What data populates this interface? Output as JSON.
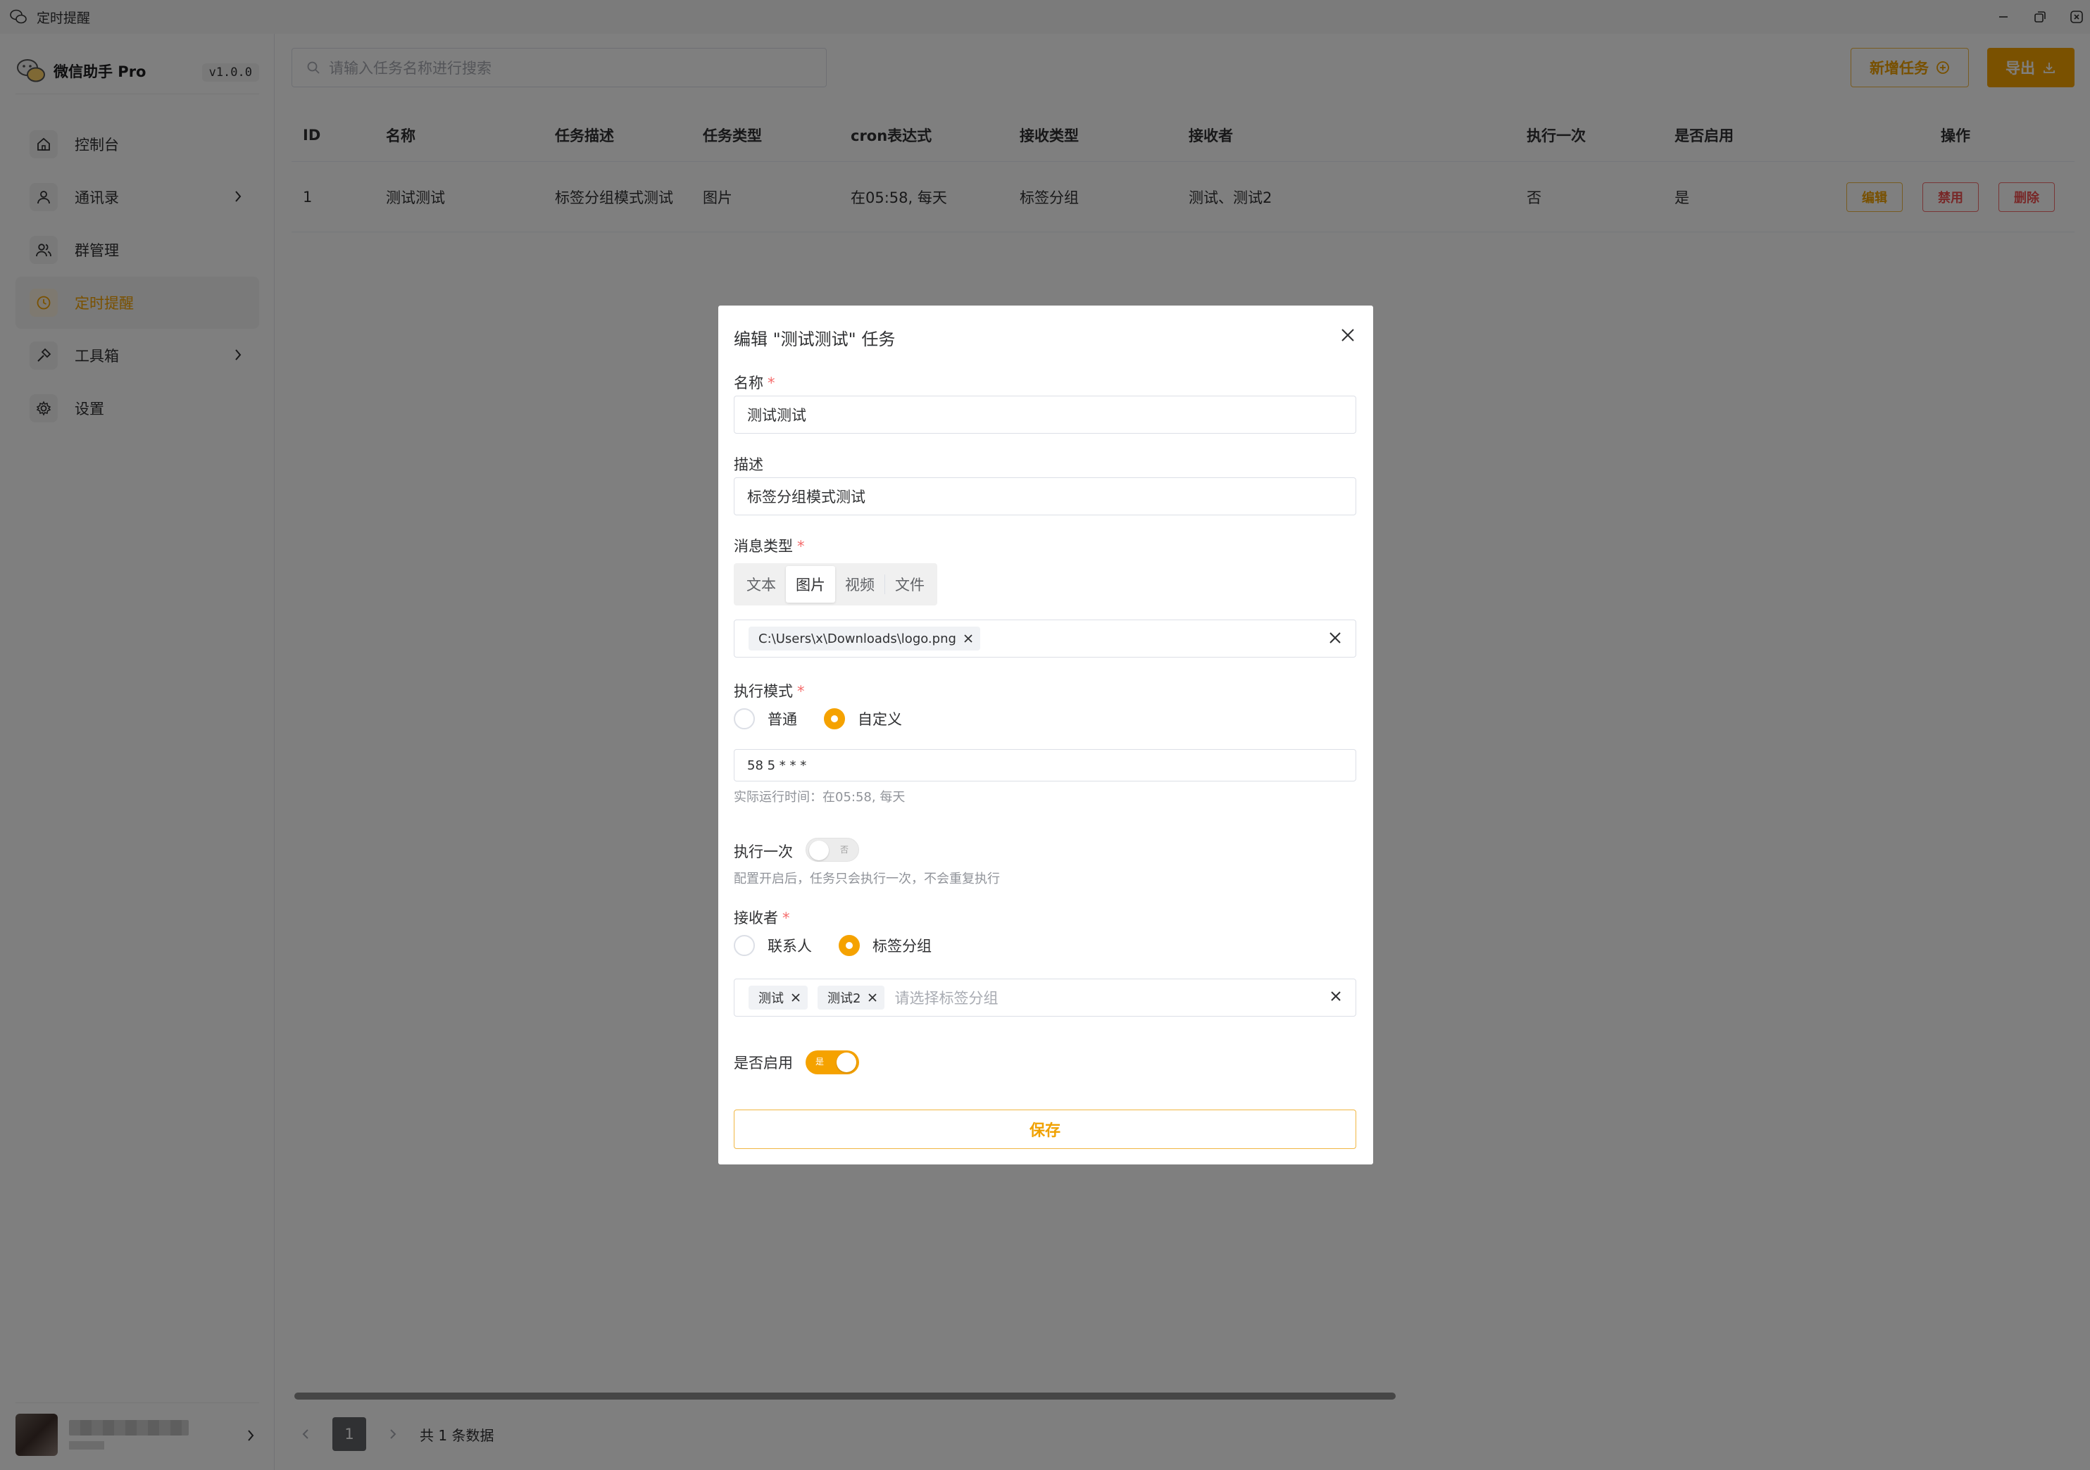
{
  "window": {
    "title": "定时提醒",
    "icons": {
      "app": "wechat-icon",
      "minimize": "minimize-icon",
      "restore": "restore-icon",
      "close": "close-icon"
    }
  },
  "sidebar": {
    "brand": "微信助手 Pro",
    "version": "v1.0.0",
    "items": [
      {
        "label": "控制台",
        "icon": "home-icon",
        "has_children": false
      },
      {
        "label": "通讯录",
        "icon": "user-icon",
        "has_children": true
      },
      {
        "label": "群管理",
        "icon": "users-icon",
        "has_children": false
      },
      {
        "label": "定时提醒",
        "icon": "clock-icon",
        "has_children": false,
        "active": true
      },
      {
        "label": "工具箱",
        "icon": "hammer-icon",
        "has_children": true
      },
      {
        "label": "设置",
        "icon": "gear-icon",
        "has_children": false
      }
    ]
  },
  "toolbar": {
    "search_placeholder": "请输入任务名称进行搜索",
    "new_task_label": "新增任务",
    "export_label": "导出"
  },
  "table": {
    "columns": [
      "ID",
      "名称",
      "任务描述",
      "任务类型",
      "cron表达式",
      "接收类型",
      "接收者",
      "执行一次",
      "是否启用",
      "操作"
    ],
    "rows": [
      [
        "1",
        "测试测试",
        "标签分组模式测试",
        "图片",
        "在05:58, 每天",
        "标签分组",
        "测试、测试2",
        "否",
        "是"
      ]
    ],
    "actions": {
      "edit": "编辑",
      "disable": "禁用",
      "delete": "删除"
    }
  },
  "pagination": {
    "current_page": "1",
    "total_text": "共 1 条数据"
  },
  "dialog": {
    "title": "编辑 \"测试测试\" 任务",
    "name_label": "名称",
    "name_value": "测试测试",
    "desc_label": "描述",
    "desc_value": "标签分组模式测试",
    "msg_type_label": "消息类型",
    "msg_types": [
      "文本",
      "图片",
      "视频",
      "文件"
    ],
    "msg_type_selected": "图片",
    "file_tag": "C:\\Users\\x\\Downloads\\logo.png",
    "exec_mode_label": "执行模式",
    "exec_modes": [
      "普通",
      "自定义"
    ],
    "exec_mode_selected": "自定义",
    "cron_value": "58 5 * * *",
    "cron_hint": "实际运行时间：在05:58, 每天",
    "run_once_label": "执行一次",
    "run_once_switch_text": "否",
    "run_once_on": false,
    "run_once_hint": "配置开启后，任务只会执行一次，不会重复执行",
    "receiver_label": "接收者",
    "receiver_types": [
      "联系人",
      "标签分组"
    ],
    "receiver_type_selected": "标签分组",
    "receiver_tags": [
      "测试",
      "测试2"
    ],
    "receiver_placeholder": "请选择标签分组",
    "enabled_label": "是否启用",
    "enabled_switch_text": "是",
    "enabled_on": true,
    "save_label": "保存"
  },
  "colors": {
    "accent": "#f5a200",
    "danger": "#f05050",
    "overlay": "rgba(0,0,0,0.5)"
  }
}
